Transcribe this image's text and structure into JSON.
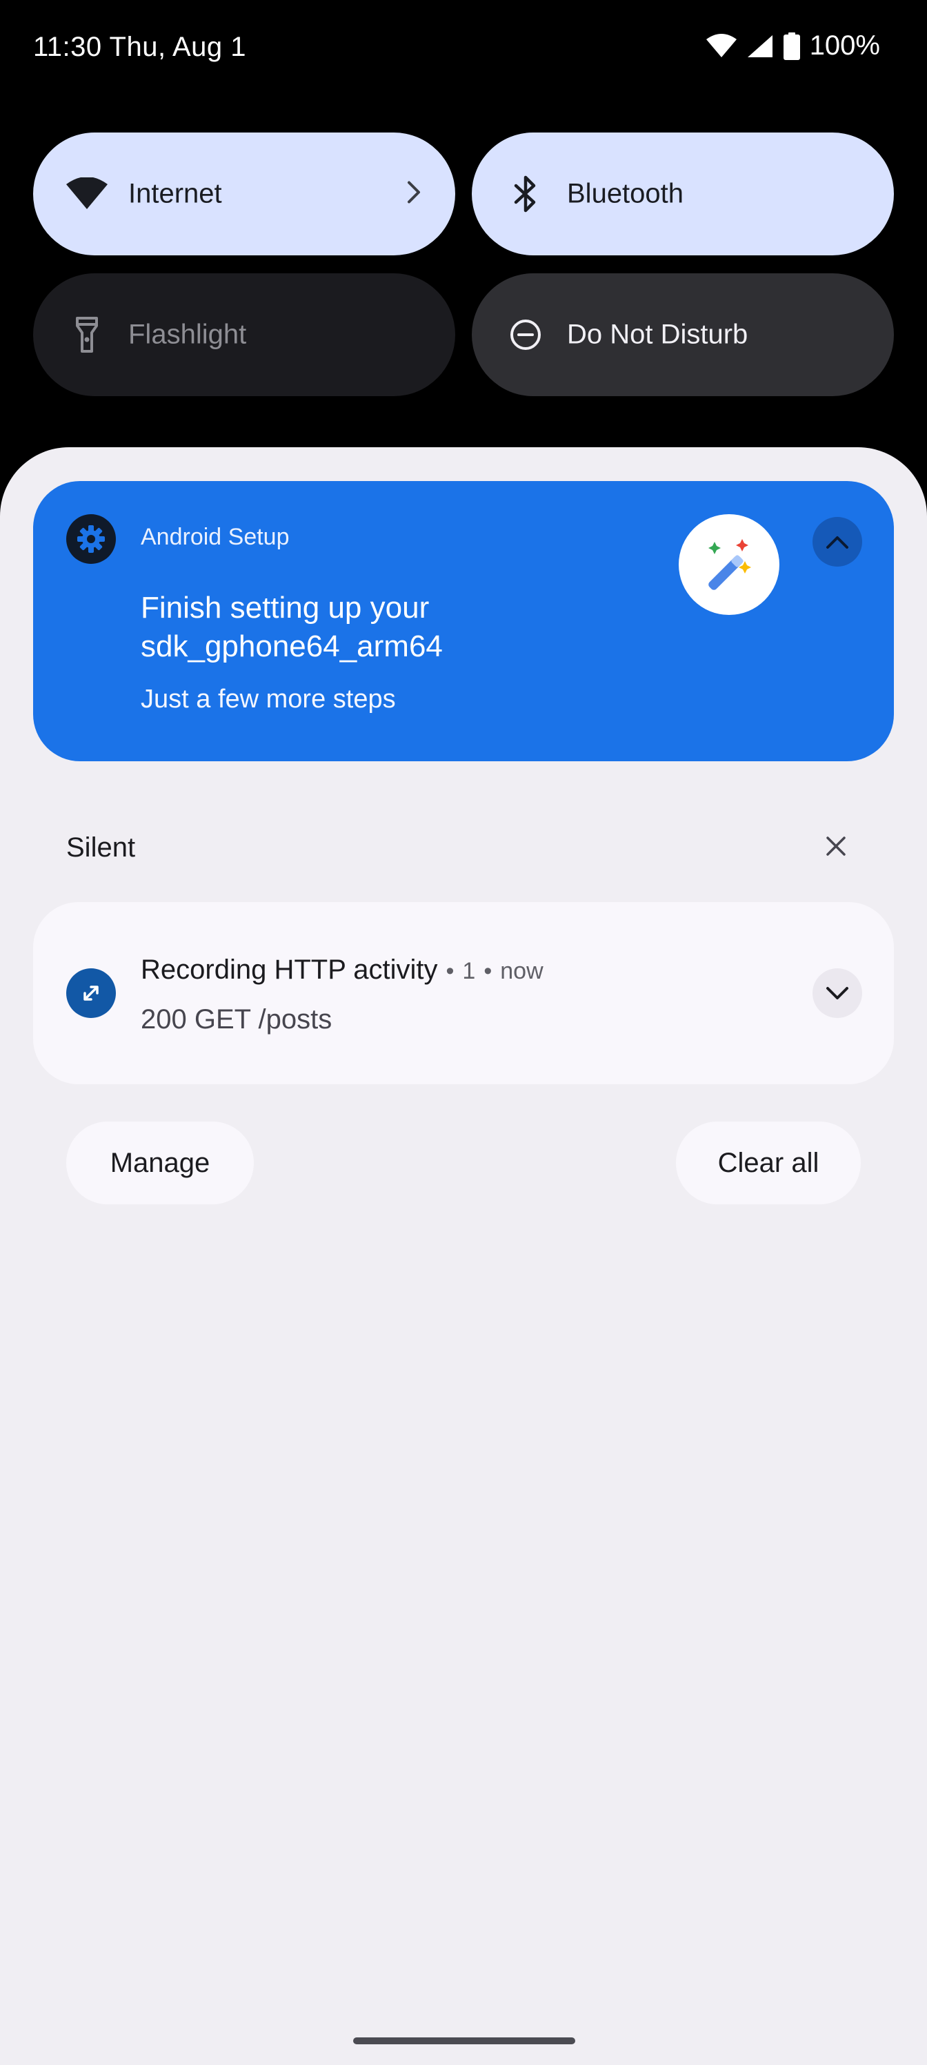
{
  "status_bar": {
    "time": "11:30",
    "date": "Thu, Aug 1",
    "battery": "100%",
    "icons": [
      "wifi-icon",
      "cell-signal-icon",
      "battery-icon"
    ]
  },
  "quick_settings": {
    "tiles": [
      {
        "label": "Internet",
        "icon": "wifi-icon",
        "state": "on",
        "has_chevron": true
      },
      {
        "label": "Bluetooth",
        "icon": "bluetooth-icon",
        "state": "on"
      },
      {
        "label": "Flashlight",
        "icon": "flashlight-icon",
        "state": "off"
      },
      {
        "label": "Do Not Disturb",
        "icon": "do-not-disturb-icon",
        "state": "off"
      }
    ]
  },
  "notifications": {
    "setup": {
      "app_name": "Android Setup",
      "title": "Finish setting up your sdk_gphone64_arm64",
      "text": "Just a few more steps",
      "accent": "#1b73e8"
    },
    "silent_section": {
      "header": "Silent",
      "items": [
        {
          "title": "Recording HTTP activity",
          "count": "1",
          "time": "now",
          "text": "200 GET /posts",
          "icon_color": "#1258a6"
        }
      ]
    }
  },
  "footer": {
    "manage_label": "Manage",
    "clear_all_label": "Clear all"
  }
}
